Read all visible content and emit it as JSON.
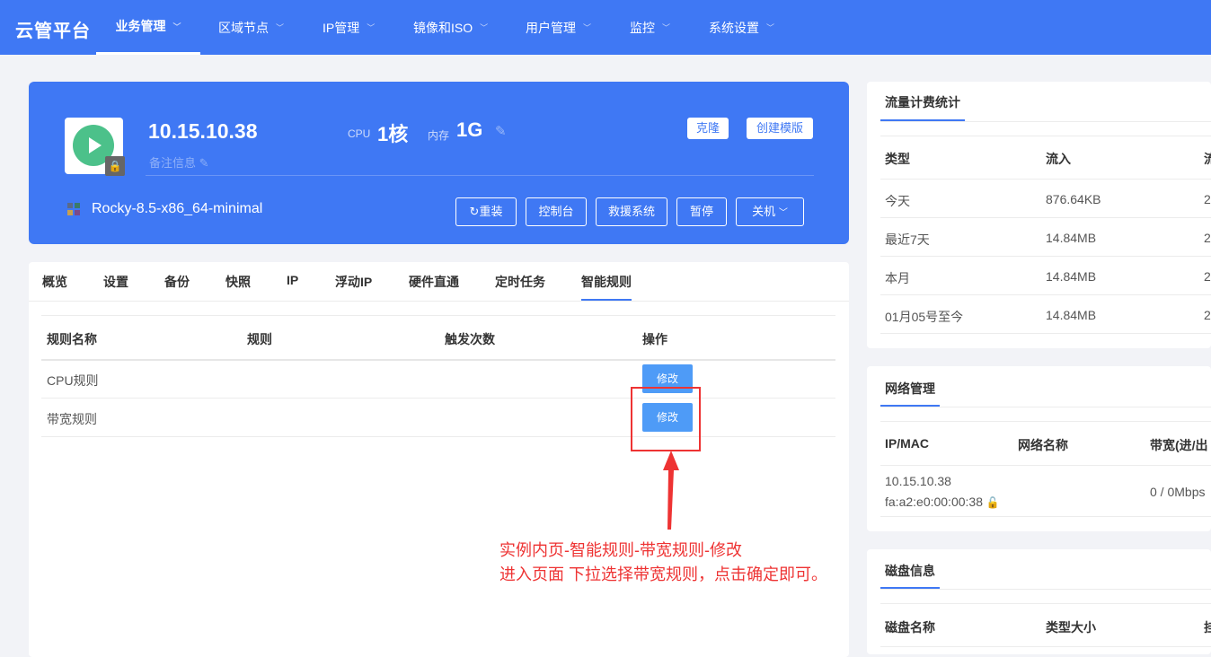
{
  "brand": "云管平台",
  "nav": [
    "业务管理",
    "区域节点",
    "IP管理",
    "镜像和ISO",
    "用户管理",
    "监控",
    "系统设置"
  ],
  "instance": {
    "ip": "10.15.10.38",
    "remark": "备注信息",
    "cpu_label": "CPU",
    "cpu_value": "1核",
    "mem_label": "内存",
    "mem_value": "1G",
    "clone": "克隆",
    "create_template": "创建模版",
    "os": "Rocky-8.5-x86_64-minimal",
    "actions": [
      "重装",
      "控制台",
      "救援系统",
      "暂停",
      "关机"
    ],
    "status_color": "#4cc18a"
  },
  "tabs": [
    "概览",
    "设置",
    "备份",
    "快照",
    "IP",
    "浮动IP",
    "硬件直通",
    "定时任务",
    "智能规则"
  ],
  "active_tab": "智能规则",
  "rules": {
    "headers": [
      "规则名称",
      "规则",
      "触发次数",
      "操作"
    ],
    "rows": [
      {
        "name": "CPU规则",
        "rule": "",
        "count": "",
        "action": "修改"
      },
      {
        "name": "带宽规则",
        "rule": "",
        "count": "",
        "action": "修改"
      }
    ]
  },
  "annotation": {
    "line1": "实例内页-智能规则-带宽规则-修改",
    "line2": "进入页面 下拉选择带宽规则，点击确定即可。"
  },
  "traffic": {
    "title": "流量计费统计",
    "headers": [
      "类型",
      "流入",
      "流"
    ],
    "rows": [
      {
        "type": "今天",
        "in": "876.64KB",
        "out": "2"
      },
      {
        "type": "最近7天",
        "in": "14.84MB",
        "out": "2"
      },
      {
        "type": "本月",
        "in": "14.84MB",
        "out": "2"
      },
      {
        "type": "01月05号至今",
        "in": "14.84MB",
        "out": "2"
      }
    ]
  },
  "network": {
    "title": "网络管理",
    "headers": [
      "IP/MAC",
      "网络名称",
      "带宽(进/出"
    ],
    "ip": "10.15.10.38",
    "mac": "fa:a2:e0:00:00:38",
    "bandwidth": "0 / 0Mbps"
  },
  "disk": {
    "title": "磁盘信息",
    "headers": [
      "磁盘名称",
      "类型大小",
      "挂"
    ]
  }
}
